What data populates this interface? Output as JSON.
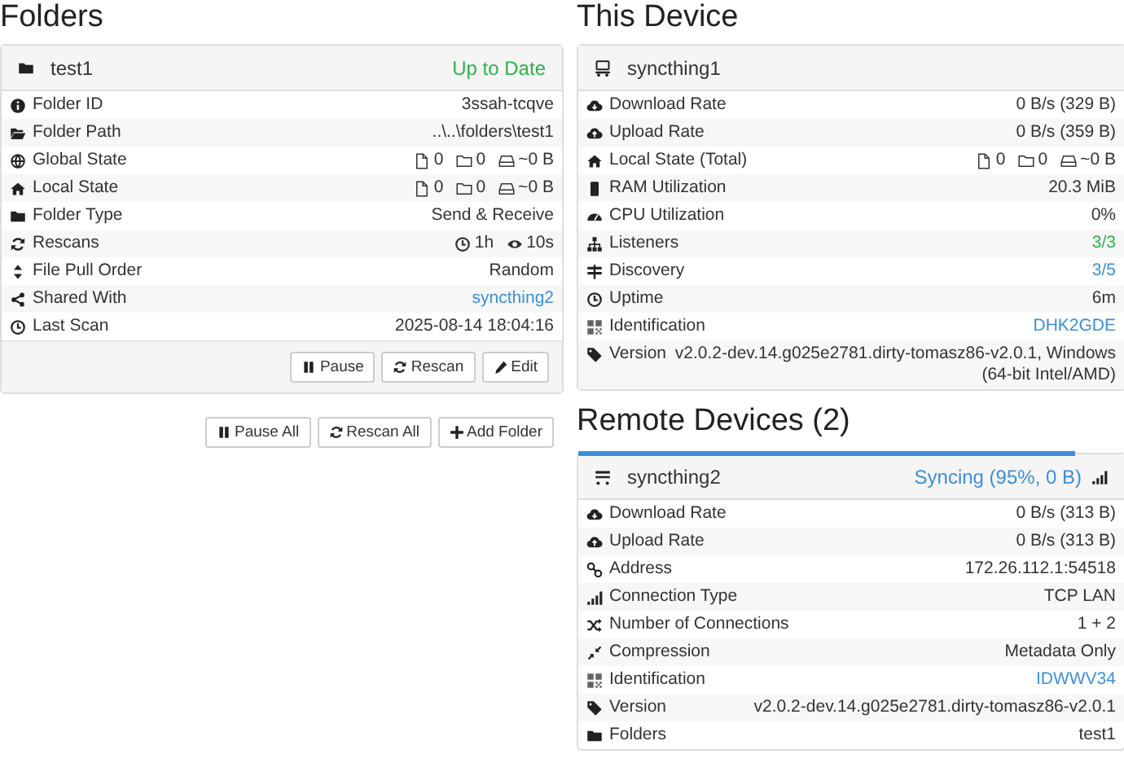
{
  "folders": {
    "heading": "Folders",
    "folder": {
      "name": "test1",
      "status": "Up to Date",
      "rows": [
        {
          "label": "Folder ID",
          "kind": "text",
          "value": "3ssah-tcqve"
        },
        {
          "label": "Folder Path",
          "kind": "text",
          "value": "..\\..\\folders\\test1"
        },
        {
          "label": "Global State",
          "kind": "stats",
          "value": {
            "files": "0",
            "dirs": "0",
            "size": "~0 B"
          }
        },
        {
          "label": "Local State",
          "kind": "stats",
          "value": {
            "files": "0",
            "dirs": "0",
            "size": "~0 B"
          }
        },
        {
          "label": "Folder Type",
          "kind": "text",
          "value": "Send & Receive"
        },
        {
          "label": "Rescans",
          "kind": "rescan",
          "value": {
            "interval": "1h",
            "watch": "10s"
          }
        },
        {
          "label": "File Pull Order",
          "kind": "text",
          "value": "Random"
        },
        {
          "label": "Shared With",
          "kind": "link",
          "value": "syncthing2"
        },
        {
          "label": "Last Scan",
          "kind": "text",
          "value": "2025-08-14 18:04:16"
        }
      ],
      "buttons": [
        "Pause",
        "Rescan",
        "Edit"
      ]
    },
    "buttons": [
      "Pause All",
      "Rescan All",
      "Add Folder"
    ]
  },
  "this_device": {
    "heading": "This Device",
    "name": "syncthing1",
    "rows": [
      {
        "label": "Download Rate",
        "kind": "text",
        "value": "0 B/s (329 B)"
      },
      {
        "label": "Upload Rate",
        "kind": "text",
        "value": "0 B/s (359 B)"
      },
      {
        "label": "Local State (Total)",
        "kind": "stats",
        "value": {
          "files": "0",
          "dirs": "0",
          "size": "~0 B"
        }
      },
      {
        "label": "RAM Utilization",
        "kind": "text",
        "value": "20.3 MiB"
      },
      {
        "label": "CPU Utilization",
        "kind": "text",
        "value": "0%"
      },
      {
        "label": "Listeners",
        "kind": "success",
        "value": "3/3"
      },
      {
        "label": "Discovery",
        "kind": "link",
        "value": "3/5"
      },
      {
        "label": "Uptime",
        "kind": "text",
        "value": "6m"
      },
      {
        "label": "Identification",
        "kind": "link",
        "value": "DHK2GDE"
      },
      {
        "label": "Version",
        "kind": "text",
        "value": "v2.0.2-dev.14.g025e2781.dirty-tomasz86-v2.0.1, Windows (64-bit Intel/AMD)"
      }
    ]
  },
  "remote_devices": {
    "heading": "Remote Devices (2)",
    "device": {
      "name": "syncthing2",
      "status": "Syncing (95%, 0 B)",
      "level": 0.95,
      "rows": [
        {
          "label": "Download Rate",
          "kind": "text",
          "value": "0 B/s (313 B)"
        },
        {
          "label": "Upload Rate",
          "kind": "text",
          "value": "0 B/s (313 B)"
        },
        {
          "label": "Address",
          "kind": "text",
          "value": "172.26.112.1:54518"
        },
        {
          "label": "Connection Type",
          "kind": "text",
          "value": "TCP LAN"
        },
        {
          "label": "Number of Connections",
          "kind": "text",
          "value": "1 + 2"
        },
        {
          "label": "Compression",
          "kind": "text",
          "value": "Metadata Only"
        },
        {
          "label": "Identification",
          "kind": "link",
          "value": "IDWWV34"
        },
        {
          "label": "Version",
          "kind": "text",
          "value": "v2.0.2-dev.14.g025e2781.dirty-tomasz86-v2.0.1"
        },
        {
          "label": "Folders",
          "kind": "text",
          "value": "test1"
        }
      ]
    }
  }
}
